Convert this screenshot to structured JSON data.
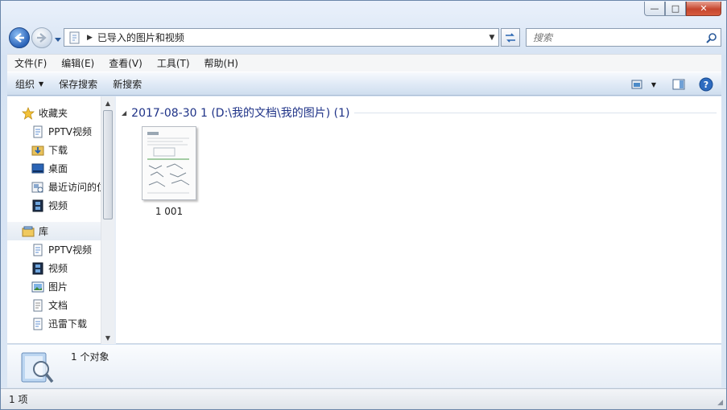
{
  "window": {
    "minimize_glyph": "—",
    "maximize_glyph": "□",
    "close_glyph": "✕"
  },
  "address": {
    "path": "已导入的图片和视频",
    "icon": "folder-path-icon"
  },
  "search": {
    "placeholder": "搜索"
  },
  "menu": [
    "文件(F)",
    "编辑(E)",
    "查看(V)",
    "工具(T)",
    "帮助(H)"
  ],
  "commands": {
    "organize": "组织",
    "save_search": "保存搜索",
    "new_search": "新搜索"
  },
  "nav": {
    "favorites_header": "收藏夹",
    "favorites": [
      "PPTV视频",
      "下载",
      "桌面",
      "最近访问的位置",
      "视频"
    ],
    "library_header": "库",
    "libraries": [
      "PPTV视频",
      "视频",
      "图片",
      "文档",
      "迅雷下载"
    ]
  },
  "content": {
    "group_title": "2017-08-30 1 (D:\\我的文档\\我的图片) (1)",
    "files": [
      {
        "name": "1 001"
      }
    ]
  },
  "details": {
    "text": "1 个对象"
  },
  "status": {
    "text": "1 项"
  },
  "colors": {
    "accent": "#1e3287",
    "chrome": "#dbe6f4"
  }
}
